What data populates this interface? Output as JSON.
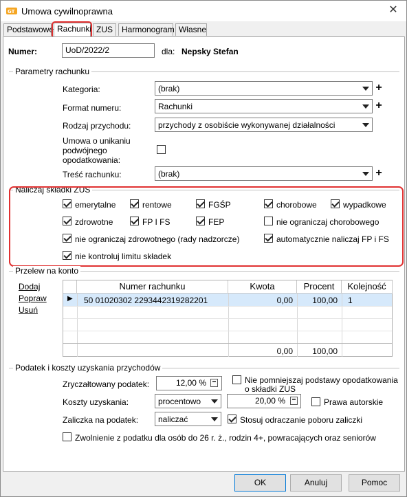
{
  "window": {
    "title": "Umowa cywilnoprawna",
    "close_icon": "close-icon"
  },
  "tabs": [
    {
      "label": "Podstawowe"
    },
    {
      "label": "Rachunki"
    },
    {
      "label": "ZUS"
    },
    {
      "label": "Harmonogram"
    },
    {
      "label": "Własne"
    }
  ],
  "header": {
    "number_label": "Numer:",
    "number_value": "UoD/2022/2",
    "for_label": "dla:",
    "for_value": "Nepsky Stefan"
  },
  "params": {
    "title": "Parametry rachunku",
    "category_label": "Kategoria:",
    "category_value": "(brak)",
    "format_label": "Format numeru:",
    "format_value": "Rachunki",
    "income_label": "Rodzaj przychodu:",
    "income_value": "przychody z osobiście wykonywanej działalności",
    "double_tax_label_1": "Umowa o unikaniu",
    "double_tax_label_2": "podwójnego",
    "double_tax_label_3": "opodatkowania:",
    "content_label": "Treść rachunku:",
    "content_value": "(brak)"
  },
  "zus": {
    "title": "Naliczaj składki ZUS",
    "emerytalne": "emerytalne",
    "rentowe": "rentowe",
    "fgsp": "FGŚP",
    "chorobowe": "chorobowe",
    "wypadkowe": "wypadkowe",
    "zdrowotne": "zdrowotne",
    "fpifs": "FP I FS",
    "fep": "FEP",
    "no_limit_sick": "nie ograniczaj chorobowego",
    "no_limit_health": "nie ograniczaj zdrowotnego (rady nadzorcze)",
    "auto_fp": "automatycznie naliczaj FP i FS",
    "no_control": "nie kontroluj limitu składek"
  },
  "transfer": {
    "title": "Przelew na konto",
    "add": "Dodaj",
    "edit": "Popraw",
    "remove": "Usuń",
    "columns": [
      "Numer rachunku",
      "Kwota",
      "Procent",
      "Kolejność"
    ],
    "rows": [
      {
        "account": "50 01020302 2293442319282201",
        "amount": "0,00",
        "percent": "100,00",
        "order": "1"
      }
    ],
    "total_amount": "0,00",
    "total_percent": "100,00"
  },
  "tax": {
    "title": "Podatek i koszty uzyskania przychodów",
    "flat_label": "Zryczałtowany podatek:",
    "flat_value": "12,00 %",
    "no_reduce_label_1": "Nie pomniejszaj podstawy opodatkowania",
    "no_reduce_label_2": "o składki ZUS",
    "costs_label": "Koszty uzyskania:",
    "costs_type": "procentowo",
    "costs_value": "20,00 %",
    "copyright_label": "Prawa autorskie",
    "advance_label": "Zaliczka na podatek:",
    "advance_value": "naliczać",
    "defer_label": "Stosuj odraczanie poboru zaliczki",
    "exempt_label": "Zwolnienie z podatku dla osób do 26 r. ż., rodzin 4+, powracających oraz seniorów"
  },
  "buttons": {
    "ok": "OK",
    "cancel": "Anuluj",
    "help": "Pomoc"
  }
}
